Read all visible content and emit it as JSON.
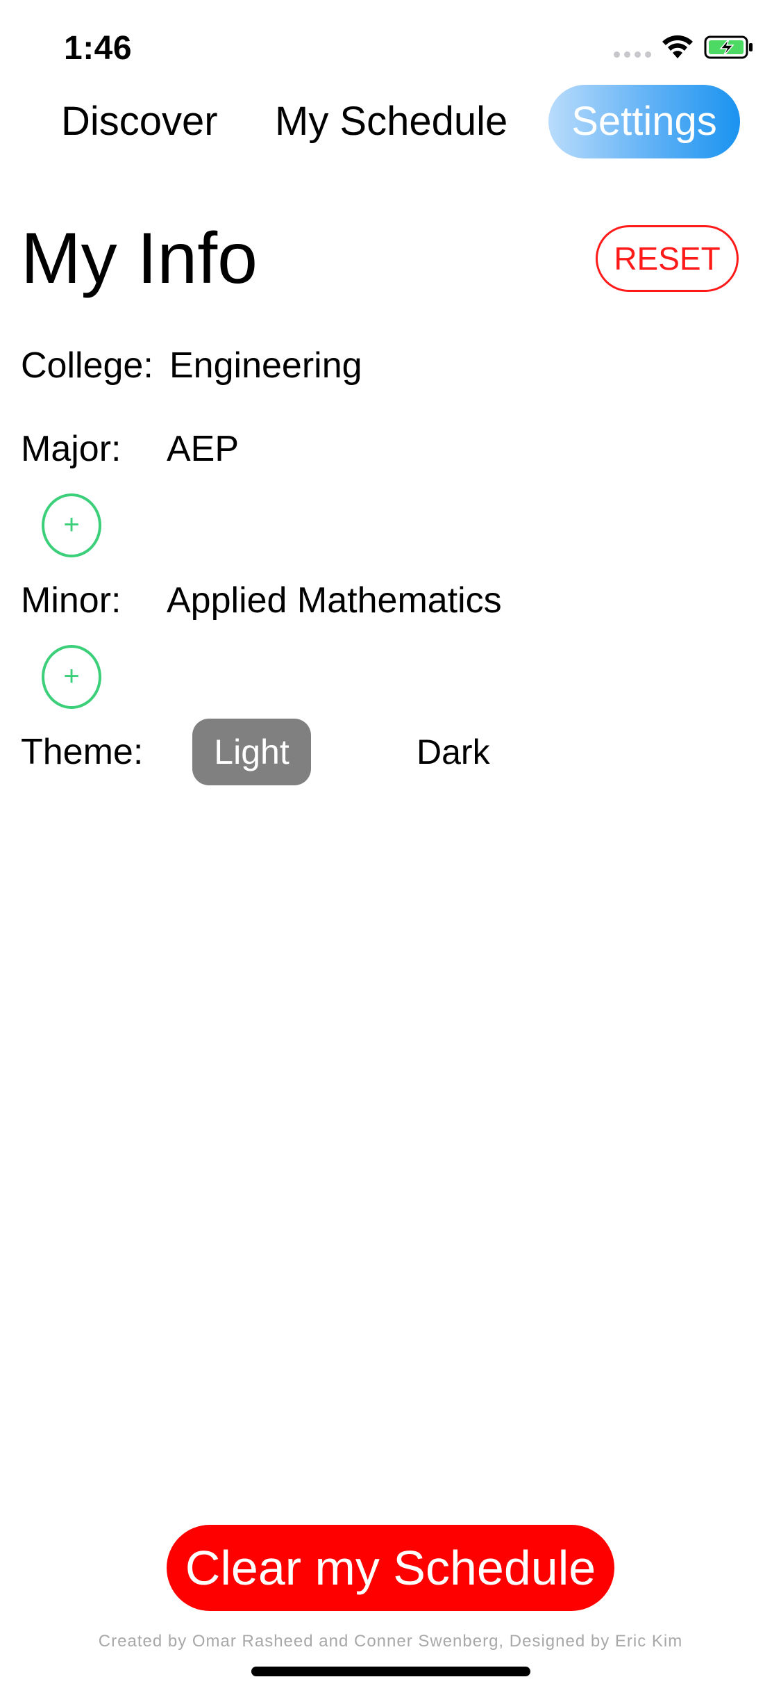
{
  "status_bar": {
    "time": "1:46",
    "icons": [
      "cellular-signal-icon",
      "wifi-icon",
      "battery-charging-icon"
    ],
    "battery_color": "#4cd964"
  },
  "nav": {
    "tabs": [
      {
        "label": "Discover",
        "active": false
      },
      {
        "label": "My Schedule",
        "active": false
      },
      {
        "label": "Settings",
        "active": true
      }
    ],
    "active_gradient": [
      "#b9dcfb",
      "#1a93f0"
    ]
  },
  "header": {
    "title": "My Info",
    "reset_label": "RESET",
    "reset_color": "#ff1a1a"
  },
  "info": {
    "college": {
      "label": "College:",
      "value": "Engineering"
    },
    "major": {
      "label": "Major:",
      "value": "AEP"
    },
    "minor": {
      "label": "Minor:",
      "value": "Applied Mathematics"
    },
    "add_symbol": "+",
    "add_color": "#3ccf7a",
    "theme": {
      "label": "Theme:",
      "options": [
        {
          "label": "Light",
          "selected": true
        },
        {
          "label": "Dark",
          "selected": false
        }
      ]
    }
  },
  "footer": {
    "clear_label": "Clear my Schedule",
    "clear_color": "#ff0000",
    "credits": "Created by Omar Rasheed and Conner Swenberg, Designed by Eric Kim"
  }
}
